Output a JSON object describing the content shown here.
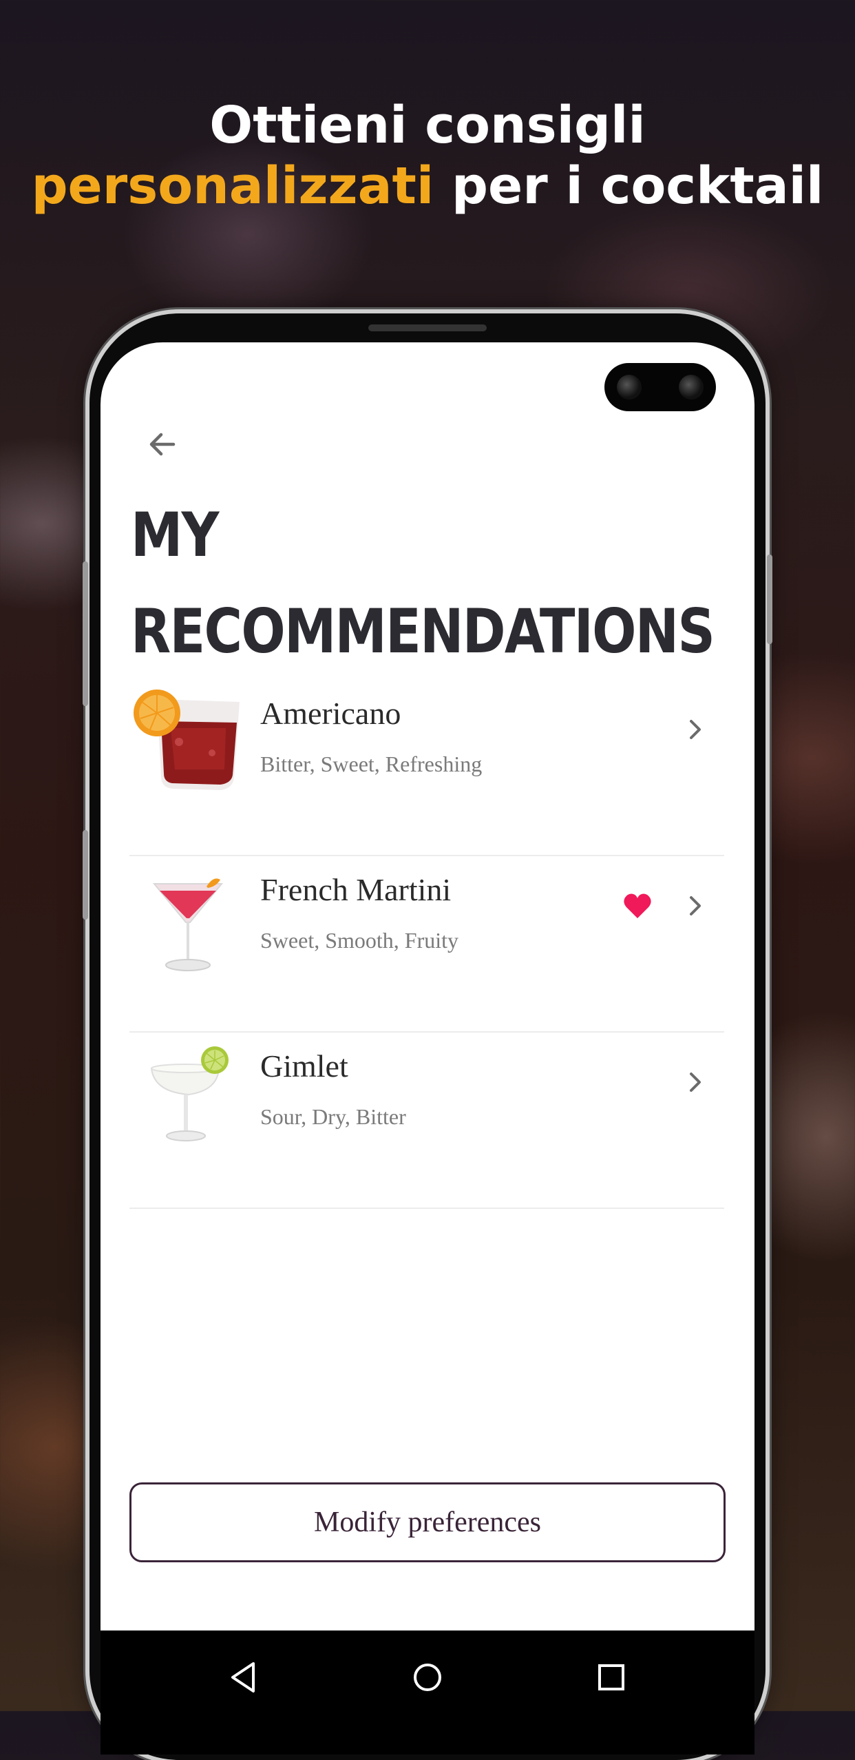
{
  "headline": {
    "line1": "Ottieni consigli",
    "accent": "personalizzati",
    "line2_rest": " per i cocktail"
  },
  "screen": {
    "title_line1": "MY",
    "title_line2": "RECOMMENDATIONS",
    "items": [
      {
        "name": "Americano",
        "tags": "Bitter, Sweet, Refreshing",
        "favorite": false
      },
      {
        "name": "French Martini",
        "tags": "Sweet, Smooth, Fruity",
        "favorite": true
      },
      {
        "name": "Gimlet",
        "tags": "Sour, Dry, Bitter",
        "favorite": false
      }
    ],
    "modify_button": "Modify preferences"
  },
  "colors": {
    "accent": "#f3a81c",
    "heart": "#f0195a",
    "button_border": "#3a2438"
  },
  "icons": [
    "back-arrow-icon",
    "chevron-right-icon",
    "heart-icon",
    "nav-back-icon",
    "nav-home-icon",
    "nav-recents-icon"
  ]
}
